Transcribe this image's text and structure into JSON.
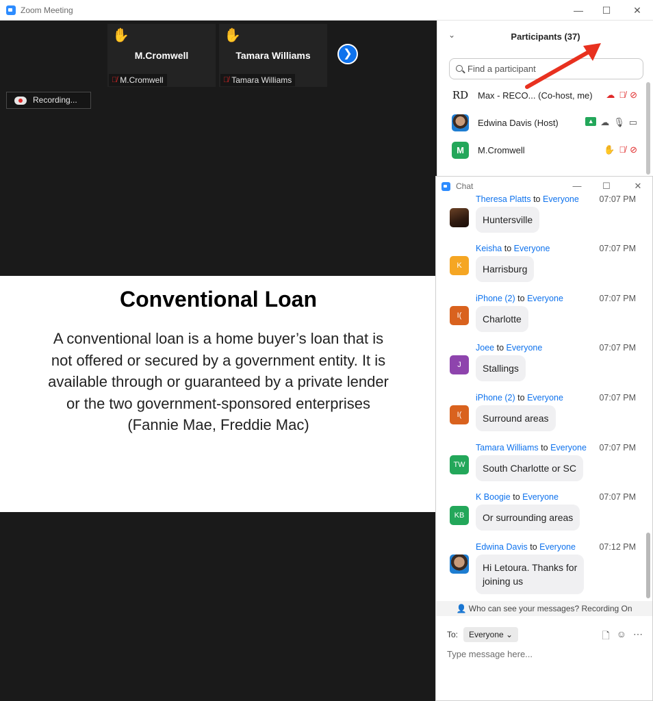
{
  "window": {
    "title": "Zoom Meeting"
  },
  "tiles": [
    {
      "name": "M.Cromwell",
      "tag": "M.Cromwell"
    },
    {
      "name": "Tamara Williams",
      "tag": "Tamara Williams"
    }
  ],
  "recording": {
    "label": "Recording..."
  },
  "slide": {
    "title": "Conventional Loan",
    "body": "A conventional loan is a home buyer’s loan that is not offered or secured by a government entity. It is available through or guaranteed by a private lender or the two government-sponsored enterprises (Fannie Mae, Freddie Mac)"
  },
  "participants": {
    "title": "Participants (37)",
    "search_placeholder": "Find a participant",
    "rows": [
      {
        "avatar": "RD",
        "name": "Max - RECO...  (Co-host, me)"
      },
      {
        "avatar": "",
        "name": "Edwina Davis (Host)"
      },
      {
        "avatar": "M",
        "name": "M.Cromwell"
      }
    ]
  },
  "chat": {
    "title": "Chat",
    "messages": [
      {
        "sender": "Theresa Platts",
        "to": "to",
        "recipient": "Everyone",
        "time": "07:07 PM",
        "text": "Huntersville",
        "avatar": ""
      },
      {
        "sender": "Keisha",
        "to": "to",
        "recipient": "Everyone",
        "time": "07:07 PM",
        "text": "Harrisburg",
        "avatar": "K"
      },
      {
        "sender": "iPhone (2)",
        "to": "to",
        "recipient": "Everyone",
        "time": "07:07 PM",
        "text": "Charlotte",
        "avatar": "I("
      },
      {
        "sender": "Joee",
        "to": "to",
        "recipient": "Everyone",
        "time": "07:07 PM",
        "text": "Stallings",
        "avatar": "J"
      },
      {
        "sender": "iPhone (2)",
        "to": "to",
        "recipient": "Everyone",
        "time": "07:07 PM",
        "text": "Surround areas",
        "avatar": "I("
      },
      {
        "sender": "Tamara Williams",
        "to": "to",
        "recipient": "Everyone",
        "time": "07:07 PM",
        "text": "South Charlotte or SC",
        "avatar": "TW"
      },
      {
        "sender": "K Boogie",
        "to": "to",
        "recipient": "Everyone",
        "time": "07:07 PM",
        "text": "Or surrounding areas",
        "avatar": "KB"
      },
      {
        "sender": "Edwina Davis",
        "to": "to",
        "recipient": "Everyone",
        "time": "07:12 PM",
        "text": "Hi Letoura. Thanks for\njoining us",
        "avatar": ""
      }
    ],
    "visibility_note": "Who can see your messages? Recording On",
    "to_label": "To:",
    "to_value": "Everyone",
    "input_placeholder": "Type message here..."
  },
  "colors": {
    "zoom_blue": "#0e72ed",
    "avatar_orange": "#f5a623",
    "avatar_rust": "#d9621e",
    "avatar_purple": "#8e44ad",
    "avatar_green": "#23a75a",
    "mute_red": "#e02828"
  },
  "icons": [
    "zoom-logo-icon",
    "minimize-icon",
    "maximize-icon",
    "close-icon",
    "raised-hand-icon",
    "mic-muted-icon",
    "chevron-right-icon",
    "cloud-record-icon",
    "search-icon",
    "video-off-icon",
    "share-screen-icon",
    "file-icon",
    "emoji-icon",
    "more-icon"
  ]
}
